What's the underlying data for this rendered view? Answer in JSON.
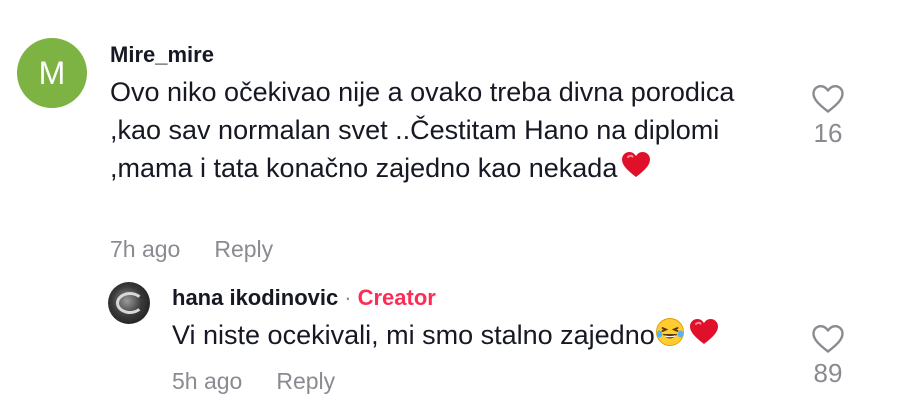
{
  "comments": [
    {
      "username": "Mire_mire",
      "avatar_letter": "M",
      "avatar_color": "#7cb342",
      "text": "Ovo niko očekivao nije a ovako treba divna porodica ,kao sav normalan svet ..Čestitam Hano na diplomi ,mama i tata konačno zajedno kao nekada",
      "emoji": "heart-emoji",
      "time": "7h ago",
      "reply_label": "Reply",
      "likes": "16"
    },
    {
      "username": "hana ikodinovic",
      "separator": "·",
      "badge": "Creator",
      "badge_color": "#fe2c55",
      "text": "Vi niste ocekivali, mi smo stalno zajedno",
      "emoji": [
        "laughing-tears-emoji",
        "heart-emoji"
      ],
      "time": "5h ago",
      "reply_label": "Reply",
      "likes": "89"
    }
  ],
  "colors": {
    "text": "#161823",
    "muted": "#8a8b91",
    "heart": "#e0102b"
  }
}
